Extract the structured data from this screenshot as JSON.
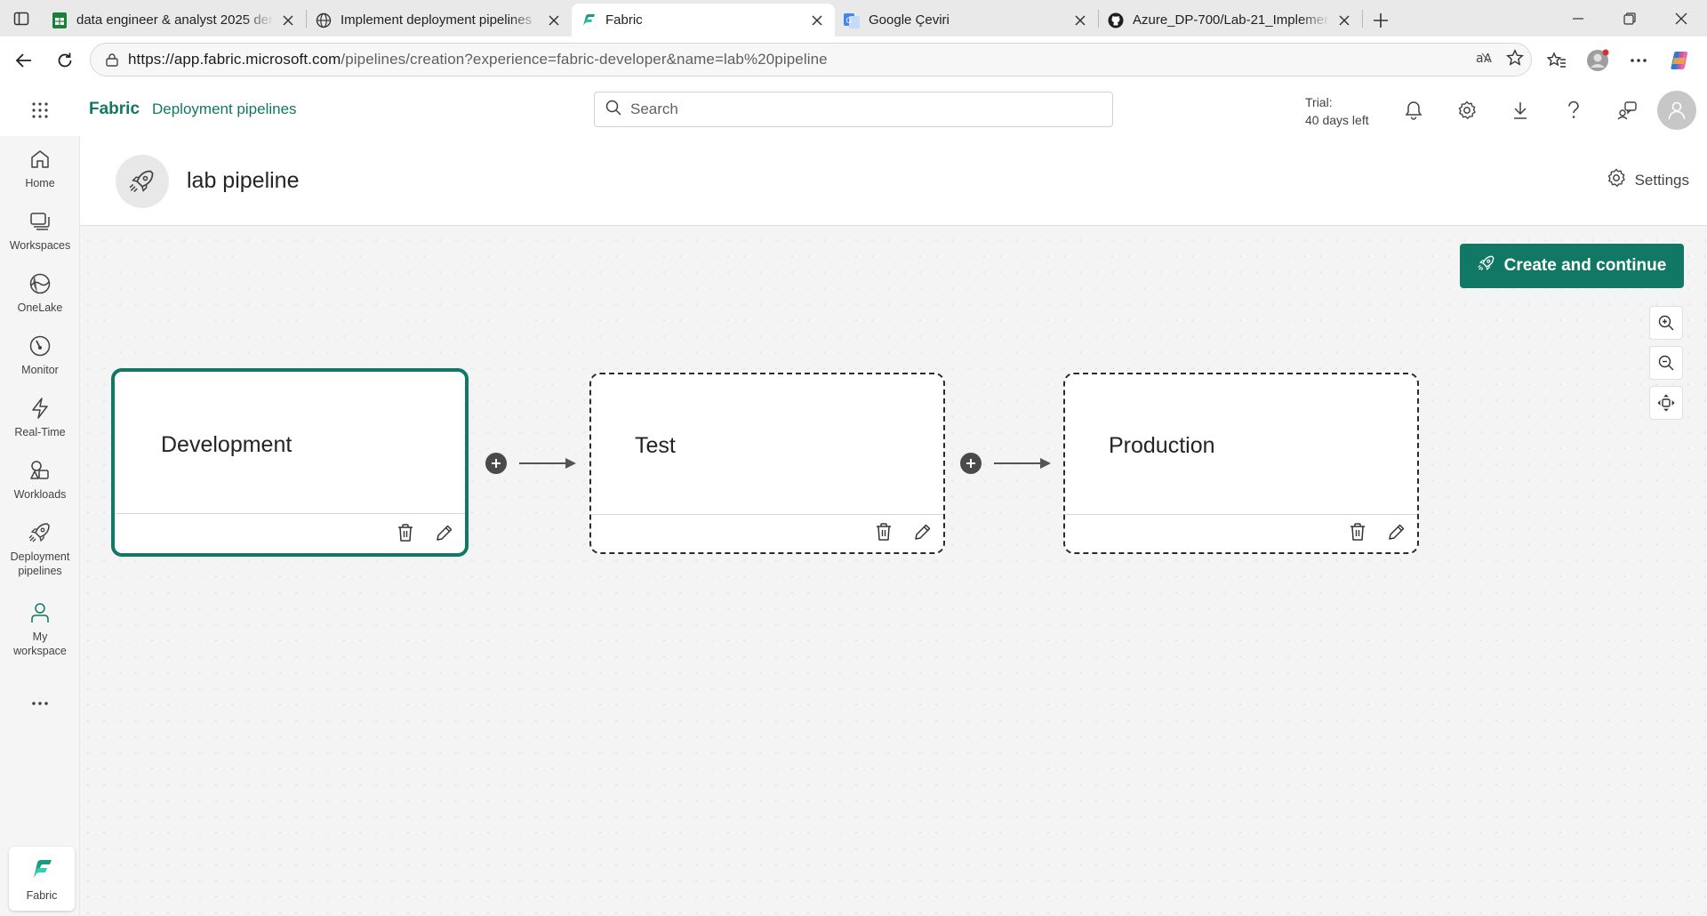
{
  "browser": {
    "tabs": [
      {
        "title": "data engineer & analyst 2025 der",
        "icon": "sheets-icon",
        "active": false
      },
      {
        "title": "Implement deployment pipelines",
        "icon": "globe-icon",
        "active": false
      },
      {
        "title": "Fabric",
        "icon": "fabric-icon",
        "active": true
      },
      {
        "title": "Google Çeviri",
        "icon": "translate-icon",
        "active": false
      },
      {
        "title": "Azure_DP-700/Lab-21_Implement",
        "icon": "github-icon",
        "active": false
      }
    ],
    "url_host": "https://app.fabric.microsoft.com",
    "url_path": "/pipelines/creation?experience=fabric-developer&name=lab%20pipeline"
  },
  "header": {
    "brand": "Fabric",
    "breadcrumb": "Deployment pipelines",
    "search_placeholder": "Search",
    "trial_line1": "Trial:",
    "trial_line2": "40 days left"
  },
  "leftnav": {
    "items": [
      {
        "label": "Home",
        "icon": "home-icon"
      },
      {
        "label": "Workspaces",
        "icon": "workspaces-icon"
      },
      {
        "label": "OneLake",
        "icon": "onelake-icon"
      },
      {
        "label": "Monitor",
        "icon": "monitor-icon"
      },
      {
        "label": "Real-Time",
        "icon": "realtime-icon"
      },
      {
        "label": "Workloads",
        "icon": "workloads-icon"
      },
      {
        "label": "Deployment pipelines",
        "icon": "deployment-pipelines-icon"
      },
      {
        "label": "My workspace",
        "icon": "my-workspace-icon"
      }
    ],
    "bottom_tile": "Fabric"
  },
  "page": {
    "title": "lab pipeline",
    "settings_label": "Settings",
    "cta_label": "Create and continue"
  },
  "stages": [
    {
      "name": "Development",
      "selected": true
    },
    {
      "name": "Test",
      "selected": false
    },
    {
      "name": "Production",
      "selected": false
    }
  ],
  "colors": {
    "accent": "#117865",
    "canvas": "#f4f4f4"
  }
}
